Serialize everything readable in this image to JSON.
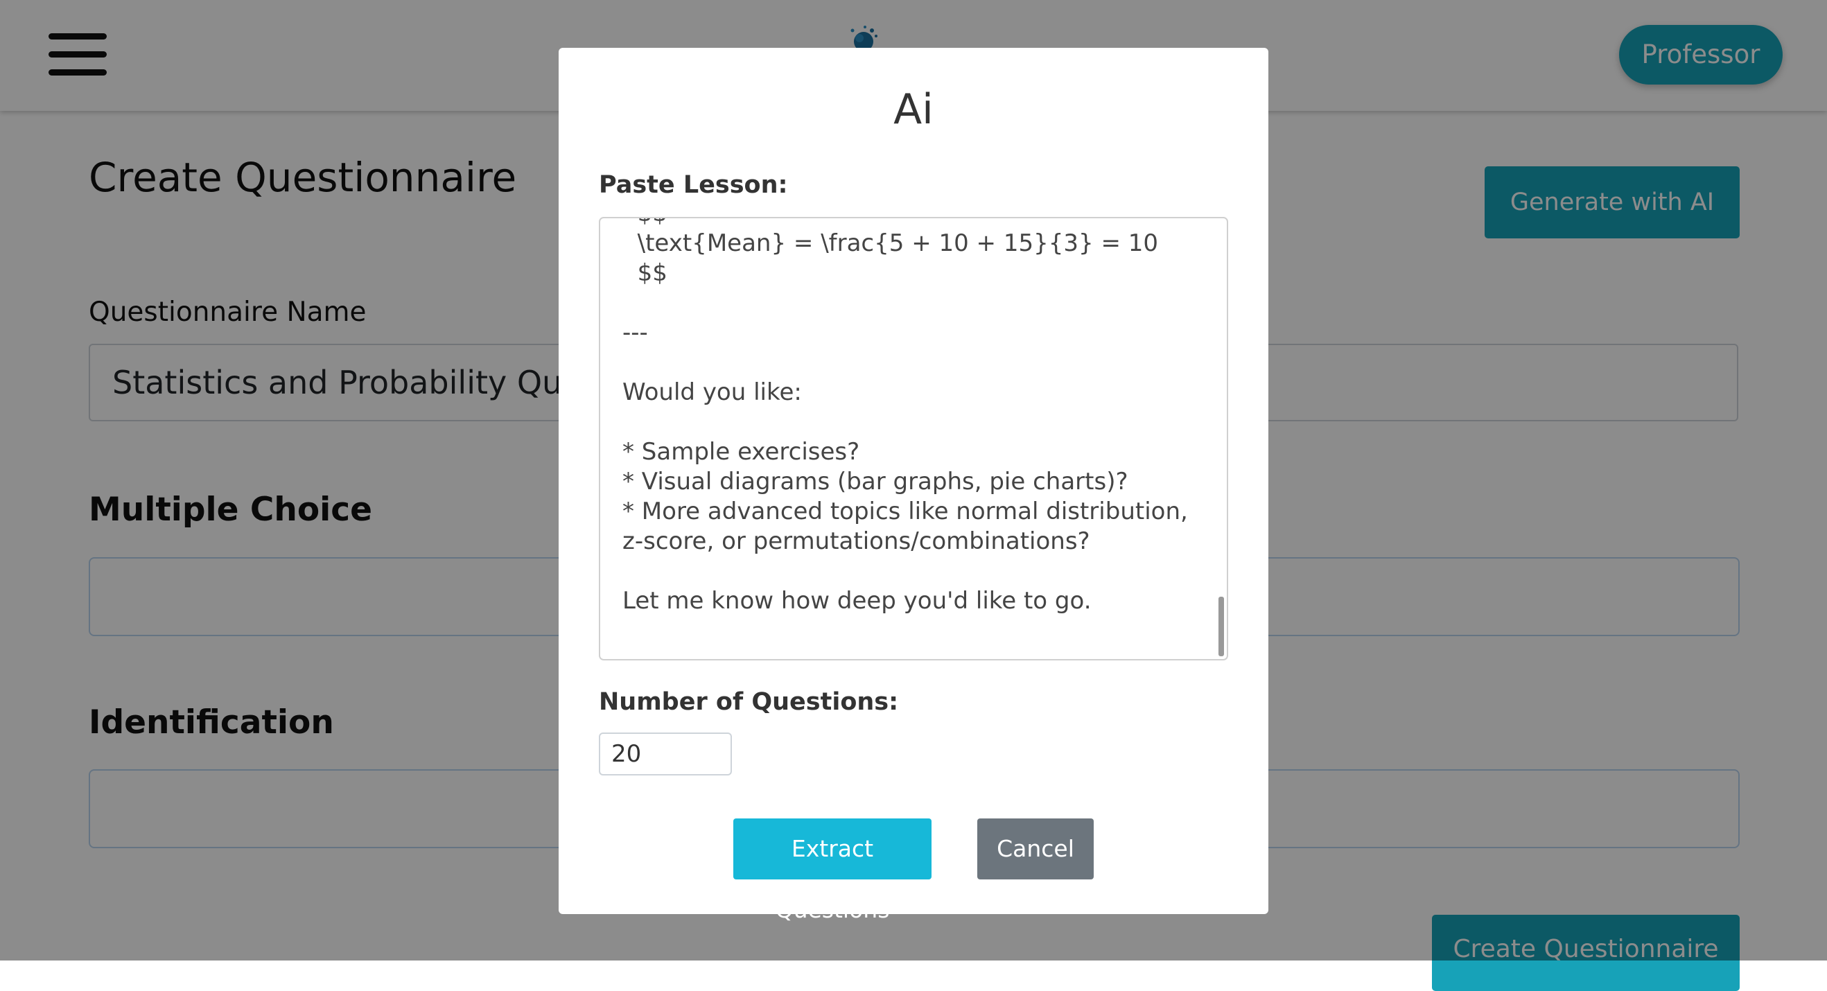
{
  "navbar": {
    "profile_label": "Professor",
    "accent": "#17a2b8"
  },
  "page": {
    "title": "Create Questionnaire",
    "generate_ai_label": "Generate with AI",
    "name_label": "Questionnaire Name",
    "name_value": "Statistics and Probability Questionnaire",
    "sections": [
      {
        "label": "Multiple Choice"
      },
      {
        "label": "Identification"
      }
    ],
    "create_label": "Create Questionnaire"
  },
  "modal": {
    "title": "Ai",
    "paste_label": "Paste Lesson:",
    "lesson_text": "  $$\n  \\text{Mean} = \\frac{5 + 10 + 15}{3} = 10\n  $$\n\n---\n\nWould you like:\n\n* Sample exercises?\n* Visual diagrams (bar graphs, pie charts)?\n* More advanced topics like normal distribution, z-score, or permutations/combinations?\n\nLet me know how deep you'd like to go.",
    "num_label": "Number of Questions:",
    "num_value": "20",
    "extract_label": "Extract Questions",
    "cancel_label": "Cancel"
  }
}
